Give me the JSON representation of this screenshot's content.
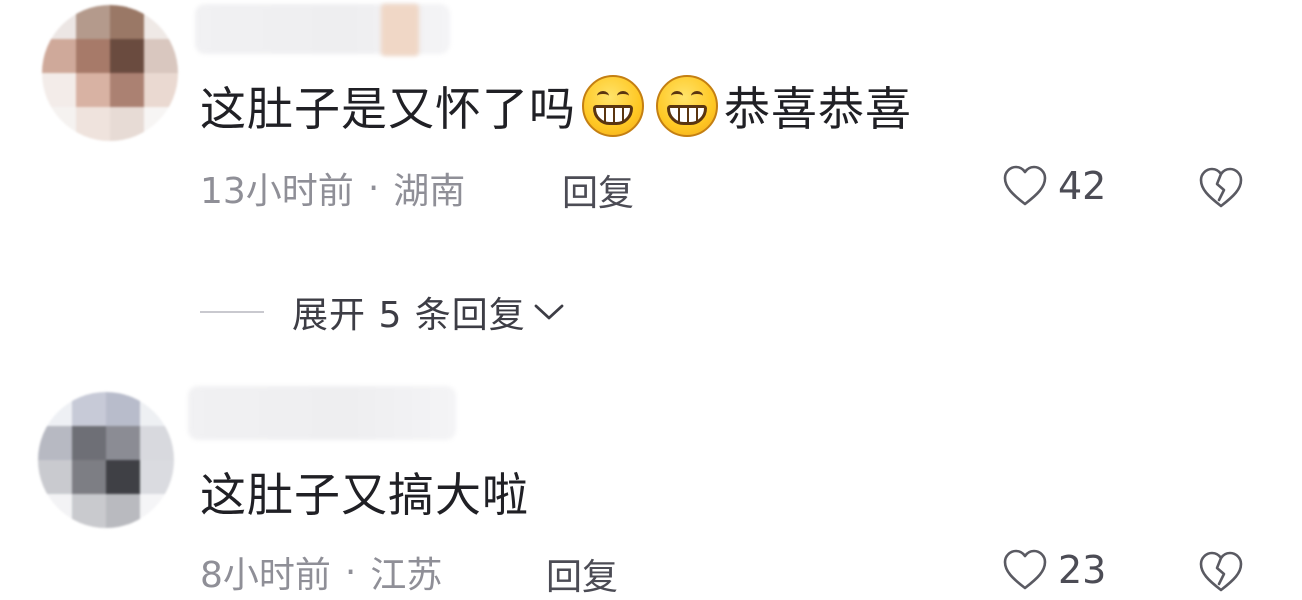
{
  "comments": [
    {
      "text_main": "这肚子是又怀了吗",
      "emoji": [
        "grin-emoji",
        "grin-emoji"
      ],
      "text_tail": "恭喜恭喜",
      "time": "13小时前",
      "location": "湖南",
      "reply_label": "回复",
      "likes": "42",
      "avatar_colors": [
        "#ece6e4",
        "#b49a8c",
        "#9a7866",
        "#efe9e6",
        "#cfa99a",
        "#a77a69",
        "#6a4b3f",
        "#d9c7bf",
        "#f3ece9",
        "#d8b2a3",
        "#ab8172",
        "#ead9d1",
        "#f5f2f0",
        "#efe3dd",
        "#e7dbd5",
        "#f7f5f4"
      ]
    },
    {
      "text_main": "这肚子又搞大啦",
      "time": "8小时前",
      "location": "江苏",
      "reply_label": "回复",
      "likes": "23",
      "avatar_colors": [
        "#eef0f4",
        "#c7cad7",
        "#b8bccb",
        "#eef0f3",
        "#b7b9c2",
        "#6e6f76",
        "#8b8c94",
        "#d8d9de",
        "#c9cacf",
        "#7d7e84",
        "#3f4045",
        "#dadbe0",
        "#f3f3f5",
        "#c9cace",
        "#b9babf",
        "#f5f5f7"
      ]
    }
  ],
  "expand_replies": "展开 5 条回复",
  "separator": "·"
}
